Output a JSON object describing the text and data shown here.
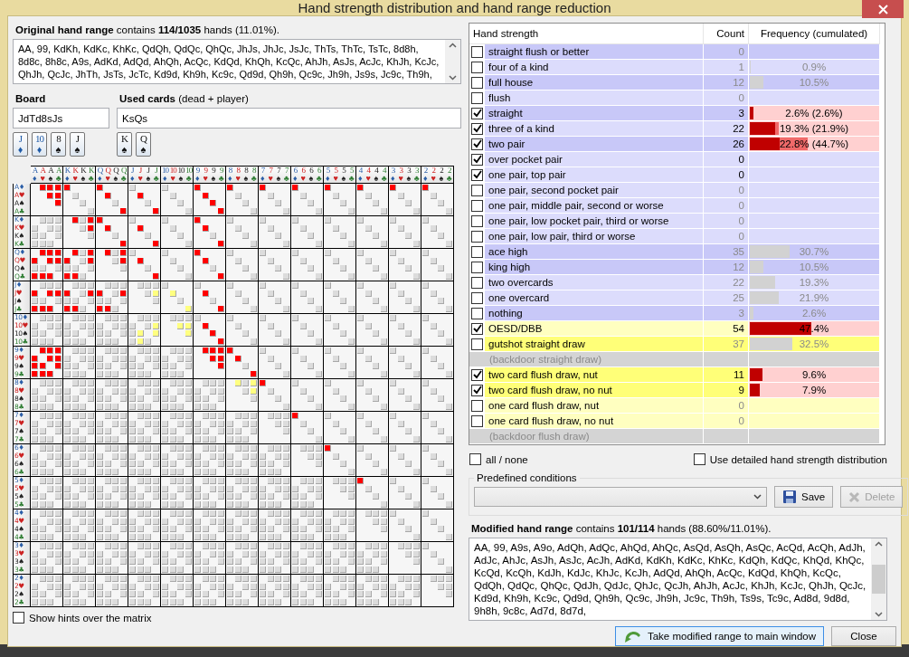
{
  "window": {
    "title": "Hand strength distribution and hand range reduction"
  },
  "original_range": {
    "summary": "**Original hand range** contains **114/1035** hands (11.01%).",
    "text": "AA, 99, KdKh, KdKc, KhKc, QdQh, QdQc, QhQc, JhJs, JhJc, JsJc, ThTs, ThTc, TsTc, 8d8h, 8d8c, 8h8c, A9s, AdKd, AdQd, AhQh, AcQc, KdQd, KhQh, KcQc, AhJh, AsJs, AcJc, KhJh, KcJc, QhJh, QcJc, JhTh, JsTs, JcTc, Kd9d, Kh9h, Kc9c, Qd9d, Qh9h, Qc9c, Jh9h, Js9s, Jc9c, Th9h,"
  },
  "board": {
    "label": "Board",
    "value": "JdTd8sJs",
    "cards": [
      {
        "rank": "J",
        "suit": "♦",
        "color": "#1f5aa6"
      },
      {
        "rank": "10",
        "suit": "♦",
        "color": "#1f5aa6"
      },
      {
        "rank": "8",
        "suit": "♠",
        "color": "#111111"
      },
      {
        "rank": "J",
        "suit": "♠",
        "color": "#111111"
      }
    ]
  },
  "used_cards": {
    "label": "**Used cards** (dead + player)",
    "value": "KsQs",
    "cards": [
      {
        "rank": "K",
        "suit": "♠",
        "color": "#111111"
      },
      {
        "rank": "Q",
        "suit": "♠",
        "color": "#111111"
      }
    ]
  },
  "matrix": {
    "columns": [
      {
        "rank": "A",
        "suit": "♦",
        "color": "#2b5ea7"
      },
      {
        "rank": "A",
        "suit": "♥",
        "color": "#cc2222"
      },
      {
        "rank": "A",
        "suit": "♠",
        "color": "#222222"
      },
      {
        "rank": "A",
        "suit": "♣",
        "color": "#2e7d32"
      },
      {
        "rank": "K",
        "suit": "♦",
        "color": "#2b5ea7"
      },
      {
        "rank": "K",
        "suit": "♥",
        "color": "#cc2222"
      },
      {
        "rank": "K",
        "suit": "♠",
        "color": "#222222"
      },
      {
        "rank": "K",
        "suit": "♣",
        "color": "#2e7d32"
      },
      {
        "rank": "Q",
        "suit": "♦",
        "color": "#2b5ea7"
      },
      {
        "rank": "Q",
        "suit": "♥",
        "color": "#cc2222"
      },
      {
        "rank": "Q",
        "suit": "♠",
        "color": "#222222"
      },
      {
        "rank": "Q",
        "suit": "♣",
        "color": "#2e7d32"
      },
      {
        "rank": "J",
        "suit": "♦",
        "color": "#2b5ea7"
      },
      {
        "rank": "J",
        "suit": "♥",
        "color": "#cc2222"
      },
      {
        "rank": "J",
        "suit": "♠",
        "color": "#222222"
      },
      {
        "rank": "J",
        "suit": "♣",
        "color": "#2e7d32"
      },
      {
        "rank": "10",
        "suit": "♦",
        "color": "#2b5ea7"
      },
      {
        "rank": "10",
        "suit": "♥",
        "color": "#cc2222"
      },
      {
        "rank": "10",
        "suit": "♠",
        "color": "#222222"
      },
      {
        "rank": "10",
        "suit": "♣",
        "color": "#2e7d32"
      },
      {
        "rank": "9",
        "suit": "♦",
        "color": "#2b5ea7"
      },
      {
        "rank": "9",
        "suit": "♥",
        "color": "#cc2222"
      },
      {
        "rank": "9",
        "suit": "♠",
        "color": "#222222"
      },
      {
        "rank": "9",
        "suit": "♣",
        "color": "#2e7d32"
      },
      {
        "rank": "8",
        "suit": "♦",
        "color": "#2b5ea7"
      },
      {
        "rank": "8",
        "suit": "♥",
        "color": "#cc2222"
      },
      {
        "rank": "8",
        "suit": "♠",
        "color": "#222222"
      },
      {
        "rank": "8",
        "suit": "♣",
        "color": "#2e7d32"
      },
      {
        "rank": "7",
        "suit": "♦",
        "color": "#2b5ea7"
      },
      {
        "rank": "7",
        "suit": "♥",
        "color": "#cc2222"
      },
      {
        "rank": "7",
        "suit": "♠",
        "color": "#222222"
      },
      {
        "rank": "7",
        "suit": "♣",
        "color": "#2e7d32"
      },
      {
        "rank": "6",
        "suit": "♦",
        "color": "#2b5ea7"
      },
      {
        "rank": "6",
        "suit": "♥",
        "color": "#cc2222"
      },
      {
        "rank": "6",
        "suit": "♠",
        "color": "#222222"
      },
      {
        "rank": "6",
        "suit": "♣",
        "color": "#2e7d32"
      },
      {
        "rank": "5",
        "suit": "♦",
        "color": "#2b5ea7"
      },
      {
        "rank": "5",
        "suit": "♥",
        "color": "#cc2222"
      },
      {
        "rank": "5",
        "suit": "♠",
        "color": "#222222"
      },
      {
        "rank": "5",
        "suit": "♣",
        "color": "#2e7d32"
      },
      {
        "rank": "4",
        "suit": "♦",
        "color": "#2b5ea7"
      },
      {
        "rank": "4",
        "suit": "♥",
        "color": "#cc2222"
      },
      {
        "rank": "4",
        "suit": "♠",
        "color": "#222222"
      },
      {
        "rank": "4",
        "suit": "♣",
        "color": "#2e7d32"
      },
      {
        "rank": "3",
        "suit": "♦",
        "color": "#2b5ea7"
      },
      {
        "rank": "3",
        "suit": "♥",
        "color": "#cc2222"
      },
      {
        "rank": "3",
        "suit": "♠",
        "color": "#222222"
      },
      {
        "rank": "3",
        "suit": "♣",
        "color": "#2e7d32"
      },
      {
        "rank": "2",
        "suit": "♦",
        "color": "#2b5ea7"
      },
      {
        "rank": "2",
        "suit": "♥",
        "color": "#cc2222"
      },
      {
        "rank": "2",
        "suit": "♠",
        "color": "#222222"
      },
      {
        "rank": "2",
        "suit": "♣",
        "color": "#2e7d32"
      }
    ],
    "rows": [
      {
        "rank": "A",
        "suit": "♦",
        "color": "#2b5ea7",
        "cells": [
          [
            null,
            true,
            true,
            true
          ],
          [
            true,
            null,
            null,
            null
          ],
          [
            true,
            null,
            null,
            null
          ],
          null,
          null,
          [
            true,
            null,
            null,
            null
          ],
          [
            true,
            null,
            null,
            null
          ],
          [
            true,
            null,
            null,
            null
          ],
          [
            true,
            null,
            null,
            null
          ],
          [
            true,
            null,
            null,
            null
          ],
          [
            true,
            null,
            null,
            null
          ],
          [
            true,
            null,
            null,
            null
          ],
          [
            true,
            null,
            null,
            null
          ]
        ]
      },
      {
        "rank": "A",
        "suit": "♥",
        "color": "#cc2222",
        "cells": [
          [
            null,
            null,
            true,
            true
          ],
          null,
          [
            null,
            true,
            null,
            null
          ],
          [
            null,
            true,
            null,
            null
          ],
          null,
          [
            null,
            true,
            null,
            null
          ],
          null,
          null,
          null,
          null,
          null,
          null,
          null
        ]
      },
      {
        "rank": "A",
        "suit": "♠",
        "color": "#222222",
        "cells": [
          [
            null,
            null,
            null,
            true
          ],
          null,
          null,
          null,
          null,
          [
            null,
            null,
            true,
            null
          ],
          null,
          null,
          null,
          null,
          null,
          null,
          null
        ]
      },
      {
        "rank": "A",
        "suit": "♣",
        "color": "#2e7d32",
        "cells": [
          null,
          null,
          [
            null,
            null,
            null,
            true
          ],
          [
            null,
            null,
            null,
            true
          ],
          null,
          [
            null,
            null,
            null,
            true
          ],
          null,
          null,
          null,
          null,
          null,
          null,
          null
        ]
      },
      {
        "rank": "K",
        "suit": "♦",
        "color": "#2b5ea7",
        "cells": [
          null,
          [
            null,
            true,
            null,
            true
          ],
          [
            true,
            null,
            null,
            null
          ],
          null,
          null,
          [
            true,
            null,
            null,
            null
          ],
          null,
          null,
          null,
          null,
          null,
          null,
          null
        ]
      },
      {
        "rank": "K",
        "suit": "♥",
        "color": "#cc2222",
        "cells": [
          null,
          [
            null,
            null,
            null,
            true
          ],
          [
            null,
            true,
            null,
            null
          ],
          [
            null,
            true,
            null,
            null
          ],
          null,
          [
            null,
            true,
            null,
            null
          ],
          null,
          null,
          null,
          null,
          null,
          null,
          null
        ]
      },
      {
        "rank": "K",
        "suit": "♠",
        "color": "#222222"
      },
      {
        "rank": "K",
        "suit": "♣",
        "color": "#2e7d32",
        "cells": [
          null,
          null,
          [
            null,
            null,
            null,
            true
          ],
          [
            null,
            null,
            null,
            true
          ],
          null,
          [
            null,
            null,
            null,
            true
          ],
          null,
          null,
          null,
          null,
          null,
          null,
          null
        ]
      },
      {
        "rank": "Q",
        "suit": "♦",
        "color": "#2b5ea7",
        "cells": [
          [
            null,
            true,
            true,
            true
          ],
          [
            null,
            true,
            null,
            true
          ],
          [
            null,
            true,
            null,
            true
          ],
          null,
          null,
          [
            true,
            null,
            null,
            null
          ],
          null,
          null,
          null,
          null,
          null,
          null,
          null
        ]
      },
      {
        "rank": "Q",
        "suit": "♥",
        "color": "#cc2222",
        "cells": [
          [
            true,
            null,
            true,
            true
          ],
          [
            true,
            null,
            null,
            true
          ],
          [
            null,
            null,
            null,
            true
          ],
          [
            null,
            true,
            null,
            null
          ],
          null,
          [
            null,
            true,
            null,
            null
          ],
          null,
          null,
          null,
          null,
          null,
          null,
          null
        ]
      },
      {
        "rank": "Q",
        "suit": "♠",
        "color": "#222222"
      },
      {
        "rank": "Q",
        "suit": "♣",
        "color": "#2e7d32",
        "cells": [
          [
            true,
            true,
            true,
            null
          ],
          [
            true,
            true,
            null,
            null
          ],
          null,
          [
            null,
            null,
            null,
            true
          ],
          null,
          [
            null,
            null,
            null,
            true
          ],
          null,
          null,
          null,
          null,
          null,
          null,
          null
        ]
      },
      {
        "rank": "J",
        "suit": "♦",
        "color": "#2b5ea7"
      },
      {
        "rank": "J",
        "suit": "♥",
        "color": "#cc2222",
        "cells": [
          [
            true,
            null,
            true,
            true
          ],
          [
            true,
            null,
            null,
            true
          ],
          [
            true,
            null,
            null,
            true
          ],
          [
            null,
            null,
            null,
            false
          ],
          [
            null,
            false,
            null,
            null
          ],
          [
            null,
            true,
            null,
            null
          ],
          null,
          null,
          null,
          null,
          null,
          null,
          null
        ]
      },
      {
        "rank": "J",
        "suit": "♠",
        "color": "#222222"
      },
      {
        "rank": "J",
        "suit": "♣",
        "color": "#2e7d32",
        "cells": [
          [
            true,
            true,
            true,
            null
          ],
          [
            true,
            true,
            null,
            null
          ],
          [
            true,
            true,
            null,
            null
          ],
          null,
          [
            null,
            null,
            null,
            false
          ],
          [
            null,
            null,
            null,
            true
          ],
          null,
          null,
          null,
          null,
          null,
          null,
          null
        ]
      },
      {
        "rank": "10",
        "suit": "♦",
        "color": "#2b5ea7"
      },
      {
        "rank": "10",
        "suit": "♥",
        "color": "#cc2222",
        "cells": [
          null,
          null,
          null,
          [
            null,
            null,
            null,
            false
          ],
          [
            null,
            null,
            false,
            false
          ],
          [
            null,
            true,
            null,
            null
          ],
          null,
          null,
          null,
          null,
          null,
          null,
          null
        ]
      },
      {
        "rank": "10",
        "suit": "♠",
        "color": "#222222",
        "cells": [
          null,
          null,
          null,
          [
            null,
            false,
            null,
            false
          ],
          [
            null,
            null,
            null,
            false
          ],
          [
            null,
            null,
            true,
            null
          ],
          null,
          null,
          null,
          null,
          null,
          null,
          null
        ]
      },
      {
        "rank": "10",
        "suit": "♣",
        "color": "#2e7d32",
        "cells": [
          null,
          null,
          null,
          [
            null,
            false,
            null,
            null
          ],
          null,
          [
            null,
            null,
            null,
            true
          ],
          null,
          null,
          null,
          null,
          null,
          null,
          null
        ]
      },
      {
        "rank": "9",
        "suit": "♦",
        "color": "#2b5ea7",
        "cells": [
          [
            null,
            true,
            true,
            true
          ],
          null,
          null,
          null,
          null,
          [
            null,
            true,
            true,
            true
          ],
          [
            true,
            null,
            null,
            null
          ],
          null,
          null,
          null,
          null,
          null,
          null
        ]
      },
      {
        "rank": "9",
        "suit": "♥",
        "color": "#cc2222",
        "cells": [
          [
            true,
            null,
            true,
            true
          ],
          null,
          null,
          null,
          null,
          [
            null,
            null,
            true,
            true
          ],
          [
            null,
            true,
            null,
            null
          ],
          null,
          null,
          null,
          null,
          null,
          null
        ]
      },
      {
        "rank": "9",
        "suit": "♠",
        "color": "#222222",
        "cells": [
          [
            true,
            true,
            null,
            true
          ],
          null,
          null,
          null,
          null,
          [
            null,
            null,
            null,
            true
          ],
          null,
          null,
          null,
          null,
          null,
          null,
          null
        ]
      },
      {
        "rank": "9",
        "suit": "♣",
        "color": "#2e7d32",
        "cells": [
          [
            true,
            true,
            true,
            null
          ],
          null,
          null,
          null,
          null,
          null,
          [
            null,
            null,
            null,
            true
          ],
          null,
          null,
          null,
          null,
          null,
          null
        ]
      },
      {
        "rank": "8",
        "suit": "♦",
        "color": "#2b5ea7",
        "cells": [
          null,
          null,
          null,
          null,
          null,
          null,
          [
            null,
            false,
            null,
            false
          ],
          [
            true,
            null,
            null,
            null
          ],
          null,
          null,
          null,
          null,
          null
        ]
      },
      {
        "rank": "8",
        "suit": "♥",
        "color": "#cc2222",
        "cells": [
          null,
          null,
          null,
          null,
          null,
          null,
          [
            null,
            null,
            null,
            false
          ],
          null,
          null,
          null,
          null,
          null,
          null
        ]
      },
      {
        "rank": "8",
        "suit": "♠",
        "color": "#222222"
      },
      {
        "rank": "8",
        "suit": "♣",
        "color": "#2e7d32"
      },
      {
        "rank": "7",
        "suit": "♦",
        "color": "#2b5ea7",
        "cells": [
          null,
          null,
          null,
          null,
          null,
          null,
          null,
          null,
          [
            true,
            null,
            null,
            null
          ],
          null,
          null,
          null,
          null
        ]
      },
      {
        "rank": "7",
        "suit": "♥",
        "color": "#cc2222"
      },
      {
        "rank": "7",
        "suit": "♠",
        "color": "#222222"
      },
      {
        "rank": "7",
        "suit": "♣",
        "color": "#2e7d32"
      },
      {
        "rank": "6",
        "suit": "♦",
        "color": "#2b5ea7",
        "cells": [
          null,
          null,
          null,
          null,
          null,
          null,
          null,
          null,
          null,
          [
            true,
            null,
            null,
            null
          ],
          null,
          null,
          null
        ]
      },
      {
        "rank": "6",
        "suit": "♥",
        "color": "#cc2222"
      },
      {
        "rank": "6",
        "suit": "♠",
        "color": "#222222"
      },
      {
        "rank": "6",
        "suit": "♣",
        "color": "#2e7d32"
      },
      {
        "rank": "5",
        "suit": "♦",
        "color": "#2b5ea7",
        "cells": [
          null,
          null,
          null,
          null,
          null,
          null,
          null,
          null,
          null,
          null,
          [
            true,
            null,
            null,
            null
          ],
          null,
          null
        ]
      },
      {
        "rank": "5",
        "suit": "♥",
        "color": "#cc2222"
      },
      {
        "rank": "5",
        "suit": "♠",
        "color": "#222222"
      },
      {
        "rank": "5",
        "suit": "♣",
        "color": "#2e7d32"
      },
      {
        "rank": "4",
        "suit": "♦",
        "color": "#2b5ea7"
      },
      {
        "rank": "4",
        "suit": "♥",
        "color": "#cc2222"
      },
      {
        "rank": "4",
        "suit": "♠",
        "color": "#222222"
      },
      {
        "rank": "4",
        "suit": "♣",
        "color": "#2e7d32"
      },
      {
        "rank": "3",
        "suit": "♦",
        "color": "#2b5ea7"
      },
      {
        "rank": "3",
        "suit": "♥",
        "color": "#cc2222"
      },
      {
        "rank": "3",
        "suit": "♠",
        "color": "#222222"
      },
      {
        "rank": "3",
        "suit": "♣",
        "color": "#2e7d32"
      },
      {
        "rank": "2",
        "suit": "♦",
        "color": "#2b5ea7"
      },
      {
        "rank": "2",
        "suit": "♥",
        "color": "#cc2222"
      },
      {
        "rank": "2",
        "suit": "♠",
        "color": "#222222"
      },
      {
        "rank": "2",
        "suit": "♣",
        "color": "#2e7d32"
      }
    ]
  },
  "hints_checkbox": {
    "label": "Show hints over the matrix",
    "checked": false
  },
  "strength_table": {
    "columns": [
      "Hand strength",
      "Count",
      "Frequency (cumulated)"
    ],
    "rows": [
      {
        "kind": "option",
        "label": "straight flush or better",
        "checked": false,
        "count": "0",
        "color": "#c8c8f8"
      },
      {
        "kind": "option",
        "label": "four of a kind",
        "checked": false,
        "count": "1",
        "frequency": "0.9%",
        "level": 0.009,
        "color": "#dcdcfc"
      },
      {
        "kind": "option",
        "label": "full house",
        "checked": false,
        "count": "12",
        "frequency": "10.5%",
        "level": 0.105,
        "color": "#c8c8f8"
      },
      {
        "kind": "option",
        "label": "flush",
        "checked": false,
        "count": "0",
        "color": "#dcdcfc"
      },
      {
        "kind": "option",
        "label": "straight",
        "checked": true,
        "count": "3",
        "frequency": "2.6% (2.6%)",
        "level": 0.026,
        "cumulated": {
          "level": 0.026
        },
        "color": "#c8c8f8"
      },
      {
        "kind": "option",
        "label": "three of a kind",
        "checked": true,
        "count": "22",
        "frequency": "19.3% (21.9%)",
        "level": 0.193,
        "cumulated": {
          "level": 0.219
        },
        "color": "#dcdcfc"
      },
      {
        "kind": "option",
        "label": "two pair",
        "checked": true,
        "count": "26",
        "frequency": "22.8% (44.7%)",
        "level": 0.228,
        "cumulated": {
          "level": 0.447
        },
        "color": "#c8c8f8"
      },
      {
        "kind": "option",
        "label": "over pocket pair",
        "checked": true,
        "count": "0",
        "color": "#dcdcfc"
      },
      {
        "kind": "option",
        "label": "one pair, top pair",
        "checked": true,
        "count": "0",
        "color": "#dcdcfc"
      },
      {
        "kind": "option",
        "label": "one pair, second pocket pair",
        "checked": false,
        "count": "0",
        "color": "#dcdcfc"
      },
      {
        "kind": "option",
        "label": "one pair, middle pair, second or worse",
        "checked": false,
        "count": "0",
        "color": "#dcdcfc"
      },
      {
        "kind": "option",
        "label": "one pair, low pocket pair, third or worse",
        "checked": false,
        "count": "0",
        "color": "#dcdcfc"
      },
      {
        "kind": "option",
        "label": "one pair, low pair, third or worse",
        "checked": false,
        "count": "0",
        "color": "#dcdcfc"
      },
      {
        "kind": "option",
        "label": "ace high",
        "checked": false,
        "count": "35",
        "frequency": "30.7%",
        "level": 0.307,
        "color": "#c8c8f8"
      },
      {
        "kind": "option",
        "label": "king high",
        "checked": false,
        "count": "12",
        "frequency": "10.5%",
        "level": 0.105,
        "color": "#c8c8f8"
      },
      {
        "kind": "option",
        "label": "two overcards",
        "checked": false,
        "count": "22",
        "frequency": "19.3%",
        "level": 0.193,
        "color": "#dcdcfc"
      },
      {
        "kind": "option",
        "label": "one overcard",
        "checked": false,
        "count": "25",
        "frequency": "21.9%",
        "level": 0.219,
        "color": "#dcdcfc"
      },
      {
        "kind": "option",
        "label": "nothing",
        "checked": false,
        "count": "3",
        "frequency": "2.6%",
        "level": 0.026,
        "color": "#c8c8f8"
      },
      {
        "kind": "option",
        "label": "OESD/DBB",
        "checked": true,
        "count": "54",
        "frequency": "47.4%",
        "level": 0.474,
        "color": "#ffffc0"
      },
      {
        "kind": "option",
        "label": "gutshot straight draw",
        "checked": false,
        "count": "37",
        "frequency": "32.5%",
        "level": 0.325,
        "color": "#ffff78"
      },
      {
        "kind": "section",
        "label": "(backdoor straight draw)",
        "color": "#d4d4d4"
      },
      {
        "kind": "option",
        "label": "two card flush draw, nut",
        "checked": true,
        "count": "11",
        "frequency": "9.6%",
        "level": 0.096,
        "color": "#ffff78"
      },
      {
        "kind": "option",
        "label": "two card flush draw, no nut",
        "checked": true,
        "count": "9",
        "frequency": "7.9%",
        "level": 0.079,
        "color": "#ffff78"
      },
      {
        "kind": "option",
        "label": "one card flush draw, nut",
        "checked": false,
        "count": "0",
        "color": "#ffffc0"
      },
      {
        "kind": "option",
        "label": "one card flush draw, no nut",
        "checked": false,
        "count": "0",
        "color": "#ffffc0"
      },
      {
        "kind": "section",
        "label": "(backdoor flush draw)",
        "color": "#d4d4d4"
      }
    ]
  },
  "all_none": {
    "label": "all / none",
    "checked": false
  },
  "detailed": {
    "label": "Use detailed hand strength distribution",
    "checked": false
  },
  "predefined": {
    "title": "Predefined conditions",
    "save": "Save",
    "delete": "Delete",
    "delete_disabled": true
  },
  "modified_range": {
    "summary": "**Modified hand range** contains **101/114** hands (88.60%/11.01%).",
    "text": "AA, 99, A9s, A9o, AdQh, AdQc, AhQd, AhQc, AsQd, AsQh, AsQc, AcQd, AcQh, AdJh, AdJc, AhJc, AsJh, AsJc, AcJh, AdKd, KdKh, KdKc, KhKc, KdQh, KdQc, KhQd, KhQc, KcQd, KcQh, KdJh, KdJc, KhJc, KcJh, AdQd, AhQh, AcQc, KdQd, KhQh, KcQc, QdQh, QdQc, QhQc, QdJh, QdJc, QhJc, QcJh, AhJh, AcJc, KhJh, KcJc, QhJh, QcJc, Kd9d, Kh9h, Kc9c, Qd9d, Qh9h, Qc9c, Jh9h, Jc9c, Th9h, Ts9s, Tc9c, Ad8d, 9d8d, 9h8h, 9c8c, Ad7d, 8d7d,"
  },
  "buttons": {
    "take": "Take modified range to main window",
    "close": "Close"
  }
}
